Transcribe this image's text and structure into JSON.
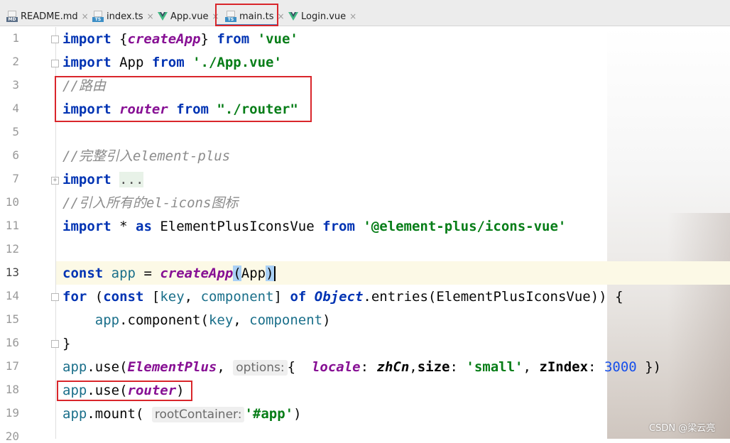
{
  "tabs": [
    {
      "label": "README.md",
      "icon": "markdown-icon",
      "close": "×"
    },
    {
      "label": "index.ts",
      "icon": "typescript-icon",
      "close": "×"
    },
    {
      "label": "App.vue",
      "icon": "vue-icon",
      "close": "×"
    },
    {
      "label": "main.ts",
      "icon": "typescript-icon",
      "close": "×",
      "active": true
    },
    {
      "label": "Login.vue",
      "icon": "vue-icon",
      "close": "×"
    }
  ],
  "icon_labels": {
    "md": "MD",
    "ts": "TS"
  },
  "line_numbers": [
    "1",
    "2",
    "3",
    "4",
    "5",
    "6",
    "7",
    "10",
    "11",
    "12",
    "13",
    "14",
    "15",
    "16",
    "17",
    "18",
    "19",
    "20"
  ],
  "current_line": "13",
  "code": {
    "l1": {
      "import": "import",
      "brace_open": "{",
      "createApp": "createApp",
      "brace_close": "}",
      "from": "from",
      "str": "'vue'"
    },
    "l2": {
      "import": "import",
      "app": "App",
      "from": "from",
      "str": "'./App.vue'"
    },
    "l3": {
      "comment": "//路由"
    },
    "l4": {
      "import": "import",
      "router": "router",
      "from": "from",
      "str": "\"./router\""
    },
    "l6": {
      "comment": "//完整引入element-plus"
    },
    "l7": {
      "import": "import",
      "dots": "..."
    },
    "l10": {
      "comment": "//引入所有的el-icons图标"
    },
    "l11": {
      "import": "import",
      "star": "*",
      "as": "as",
      "name": "ElementPlusIconsVue",
      "from": "from",
      "str": "'@element-plus/icons-vue'"
    },
    "l13": {
      "const": "const",
      "app": "app",
      "eq": "=",
      "createApp": "createApp",
      "paren_open": "(",
      "arg": "App",
      "paren_close": ")"
    },
    "l14": {
      "for": "for",
      "p1": "(",
      "const": "const",
      "bracket_open": "[",
      "key": "key",
      "comma": ",",
      "component": "component",
      "bracket_close": "]",
      "of": "of",
      "object": "Object",
      "entries": ".entries(",
      "arg": "ElementPlusIconsVue",
      "close": "))",
      "brace": "{"
    },
    "l15": {
      "app": "app",
      "call": ".component(",
      "key": "key",
      "comma": ",",
      "component": "component",
      "close": ")"
    },
    "l16": {
      "brace": "}"
    },
    "l17": {
      "app": "app",
      "use": ".use(",
      "ep": "ElementPlus",
      "comma": ",",
      "hint": "options:",
      "open": "{",
      "locale": "locale",
      "colon1": ":",
      "zhcn": "zhCn",
      "comma2": ",",
      "size": "size",
      "colon2": ":",
      "small": "'small'",
      "comma3": ",",
      "zindex": "zIndex",
      "colon3": ":",
      "n3000": "3000",
      "close": "})"
    },
    "l18": {
      "app": "app",
      "use": ".use(",
      "router": "router",
      "close": ")"
    },
    "l19": {
      "app": "app",
      "mount": ".mount(",
      "hint": "rootContainer:",
      "str": "'#app'",
      "close": ")"
    }
  },
  "watermark": "CSDN @梁云亮",
  "colors": {
    "keyword": "#0033b3",
    "string": "#067d17",
    "function": "#871094",
    "comment": "#8c8c8c",
    "highlight_box": "#d9262b",
    "current_line": "#fcf9e6"
  }
}
